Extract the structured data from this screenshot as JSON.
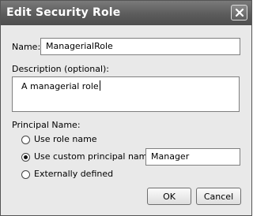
{
  "window": {
    "title": "Edit Security Role",
    "close_icon": "close-icon"
  },
  "form": {
    "name_label": "Name:",
    "name_value": "ManagerialRole",
    "description_label": "Description (optional):",
    "description_value": "A managerial role",
    "principal_label": "Principal Name:",
    "principal_options": [
      {
        "label": "Use role name",
        "selected": false
      },
      {
        "label": "Use custom principal name:",
        "selected": true
      },
      {
        "label": "Externally defined",
        "selected": false
      }
    ],
    "custom_principal_value": "Manager"
  },
  "buttons": {
    "ok_label": "OK",
    "cancel_label": "Cancel"
  },
  "colors": {
    "titlebar": "#5c5c5c",
    "dialog_bg": "#e9e9e9"
  }
}
